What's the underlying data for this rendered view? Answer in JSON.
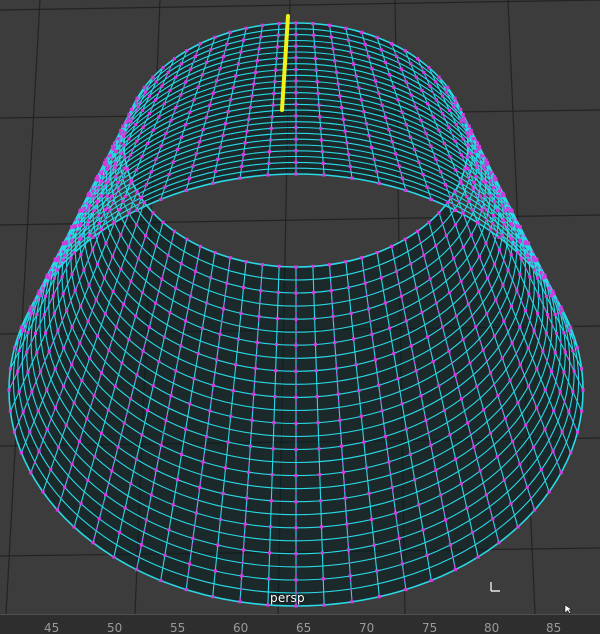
{
  "viewport": {
    "camera_label": "persp",
    "background_color": "#3c3c3c",
    "grid_color": "#1f1f1f",
    "edge_color": "#2ad8e6",
    "vertex_color": "#d23be0",
    "selected_edge_color": "#f2f21a",
    "mesh_shadow_color": "#000000"
  },
  "timeline": {
    "ticks": [
      "45",
      "50",
      "55",
      "60",
      "65",
      "70",
      "75",
      "80",
      "85"
    ]
  },
  "icons": {
    "cursor": "cursor-icon",
    "corner": "corner-marker-icon"
  }
}
